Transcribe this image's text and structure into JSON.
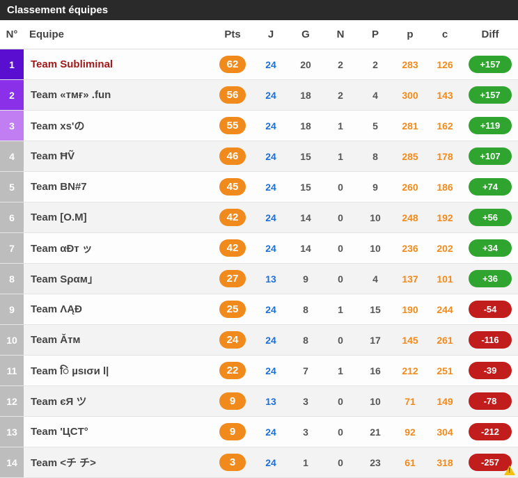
{
  "title": "Classement équipes",
  "columns": {
    "num": "N°",
    "equipe": "Equipe",
    "pts": "Pts",
    "j": "J",
    "g": "G",
    "n": "N",
    "p": "P",
    "pfor": "p",
    "pag": "c",
    "diff": "Diff"
  },
  "rows": [
    {
      "rank": 1,
      "name": "Team Subliminal",
      "pts": 62,
      "j": 24,
      "g": 20,
      "n": 2,
      "p": 2,
      "pf": 283,
      "pa": 126,
      "diff": "+157"
    },
    {
      "rank": 2,
      "name": "Team «тмғ» .fun",
      "pts": 56,
      "j": 24,
      "g": 18,
      "n": 2,
      "p": 4,
      "pf": 300,
      "pa": 143,
      "diff": "+157"
    },
    {
      "rank": 3,
      "name": "Team xs'の",
      "pts": 55,
      "j": 24,
      "g": 18,
      "n": 1,
      "p": 5,
      "pf": 281,
      "pa": 162,
      "diff": "+119"
    },
    {
      "rank": 4,
      "name": "Team ĦṼ",
      "pts": 46,
      "j": 24,
      "g": 15,
      "n": 1,
      "p": 8,
      "pf": 285,
      "pa": 178,
      "diff": "+107"
    },
    {
      "rank": 5,
      "name": "Team BN#7",
      "pts": 45,
      "j": 24,
      "g": 15,
      "n": 0,
      "p": 9,
      "pf": 260,
      "pa": 186,
      "diff": "+74"
    },
    {
      "rank": 6,
      "name": "Team [O.M]",
      "pts": 42,
      "j": 24,
      "g": 14,
      "n": 0,
      "p": 10,
      "pf": 248,
      "pa": 192,
      "diff": "+56"
    },
    {
      "rank": 7,
      "name": "Team αÐт ッ",
      "pts": 42,
      "j": 24,
      "g": 14,
      "n": 0,
      "p": 10,
      "pf": 236,
      "pa": 202,
      "diff": "+34"
    },
    {
      "rank": 8,
      "name": "Team Sραм」",
      "pts": 27,
      "j": 13,
      "g": 9,
      "n": 0,
      "p": 4,
      "pf": 137,
      "pa": 101,
      "diff": "+36"
    },
    {
      "rank": 9,
      "name": "Team ΛĄĐ",
      "pts": 25,
      "j": 24,
      "g": 8,
      "n": 1,
      "p": 15,
      "pf": 190,
      "pa": 244,
      "diff": "-54"
    },
    {
      "rank": 10,
      "name": "Team Ǎтм",
      "pts": 24,
      "j": 24,
      "g": 8,
      "n": 0,
      "p": 17,
      "pf": 145,
      "pa": 261,
      "diff": "-116"
    },
    {
      "rank": 11,
      "name": "Team ि µѕισи l|",
      "pts": 22,
      "j": 24,
      "g": 7,
      "n": 1,
      "p": 16,
      "pf": 212,
      "pa": 251,
      "diff": "-39"
    },
    {
      "rank": 12,
      "name": "Team єЯ ツ",
      "pts": 9,
      "j": 13,
      "g": 3,
      "n": 0,
      "p": 10,
      "pf": 71,
      "pa": 149,
      "diff": "-78"
    },
    {
      "rank": 13,
      "name": "Team 'ЦCТ°",
      "pts": 9,
      "j": 24,
      "g": 3,
      "n": 0,
      "p": 21,
      "pf": 92,
      "pa": 304,
      "diff": "-212"
    },
    {
      "rank": 14,
      "name": "Team <チ チ>",
      "pts": 3,
      "j": 24,
      "g": 1,
      "n": 0,
      "p": 23,
      "pf": 61,
      "pa": 318,
      "diff": "-257"
    }
  ],
  "chart_data": {
    "type": "table",
    "title": "Classement équipes",
    "columns": [
      "N°",
      "Equipe",
      "Pts",
      "J",
      "G",
      "N",
      "P",
      "p",
      "c",
      "Diff"
    ],
    "rows": [
      [
        1,
        "Team Subliminal",
        62,
        24,
        20,
        2,
        2,
        283,
        126,
        157
      ],
      [
        2,
        "Team «тмғ» .fun",
        56,
        24,
        18,
        2,
        4,
        300,
        143,
        157
      ],
      [
        3,
        "Team xs'の",
        55,
        24,
        18,
        1,
        5,
        281,
        162,
        119
      ],
      [
        4,
        "Team ĦṼ",
        46,
        24,
        15,
        1,
        8,
        285,
        178,
        107
      ],
      [
        5,
        "Team BN#7",
        45,
        24,
        15,
        0,
        9,
        260,
        186,
        74
      ],
      [
        6,
        "Team [O.M]",
        42,
        24,
        14,
        0,
        10,
        248,
        192,
        56
      ],
      [
        7,
        "Team αÐт ッ",
        42,
        24,
        14,
        0,
        10,
        236,
        202,
        34
      ],
      [
        8,
        "Team Sραм」",
        27,
        13,
        9,
        0,
        4,
        137,
        101,
        36
      ],
      [
        9,
        "Team ΛĄĐ",
        25,
        24,
        8,
        1,
        15,
        190,
        244,
        -54
      ],
      [
        10,
        "Team Ǎтм",
        24,
        24,
        8,
        0,
        17,
        145,
        261,
        -116
      ],
      [
        11,
        "Team ि µѕισи l|",
        22,
        24,
        7,
        1,
        16,
        212,
        251,
        -39
      ],
      [
        12,
        "Team єЯ ツ",
        9,
        13,
        3,
        0,
        10,
        71,
        149,
        -78
      ],
      [
        13,
        "Team 'ЦCТ°",
        9,
        24,
        3,
        0,
        21,
        92,
        304,
        -212
      ],
      [
        14,
        "Team <チ チ>",
        3,
        24,
        1,
        0,
        23,
        61,
        318,
        -257
      ]
    ]
  }
}
